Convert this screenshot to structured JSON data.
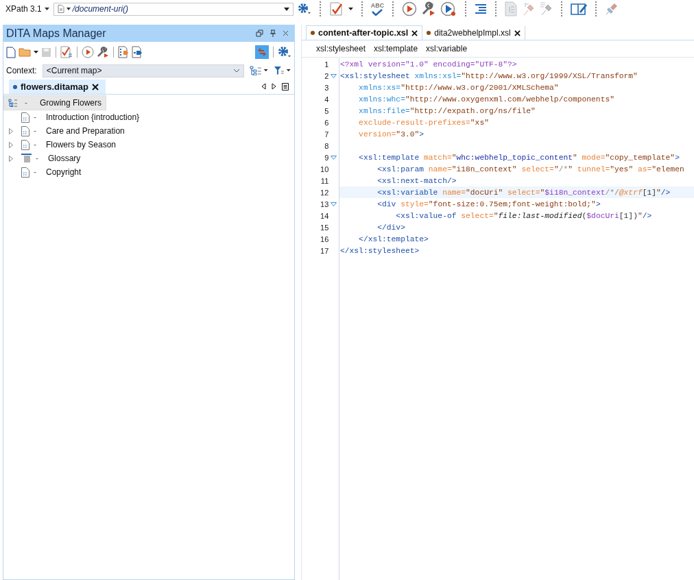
{
  "toolbar": {
    "xpath_version": "XPath 3.1",
    "xpath_expression": "/document-uri()",
    "spell_icon_text": "ABC"
  },
  "maps_manager": {
    "title": "DITA Maps Manager",
    "context_label": "Context:",
    "context_value": "<Current map>",
    "tabs": [
      {
        "label": "flowers.ditamap",
        "selected": true
      }
    ],
    "tree": [
      {
        "label": "Growing Flowers",
        "separator": "-",
        "kind": "map",
        "selected": true,
        "children": [
          {
            "label": "Introduction {introduction}",
            "separator": "-",
            "kind": "topic",
            "expandable": false,
            "selected": false
          },
          {
            "label": "Care and Preparation",
            "separator": "-",
            "kind": "topic",
            "expandable": true,
            "selected": false
          },
          {
            "label": "Flowers by Season",
            "separator": "-",
            "kind": "topic",
            "expandable": true,
            "selected": false
          },
          {
            "label": "Glossary",
            "separator": "-",
            "kind": "glossary",
            "expandable": true,
            "selected": false
          },
          {
            "label": "Copyright",
            "separator": "-",
            "kind": "topic",
            "expandable": false,
            "selected": false
          }
        ]
      }
    ]
  },
  "editor": {
    "tabs": [
      {
        "label": "content-after-topic.xsl",
        "selected": true
      },
      {
        "label": "dita2webhelpImpl.xsl",
        "selected": false
      }
    ],
    "breadcrumb": [
      "xsl:stylesheet",
      "xsl:template",
      "xsl:variable"
    ],
    "lines": [
      {
        "num": "1",
        "fold": false,
        "current": false,
        "tokens": [
          {
            "kind": "pi",
            "text": "<?xml version=\"1.0\" encoding=\"UTF-8\"?>"
          }
        ]
      },
      {
        "num": "2",
        "fold": true,
        "current": false,
        "tokens": [
          {
            "kind": "tag",
            "text": "<xsl:stylesheet "
          },
          {
            "kind": "ns",
            "text": "xmlns:xsl="
          },
          {
            "kind": "value",
            "text": "\"http://www.w3.org/1999/XSL/Transform\""
          }
        ]
      },
      {
        "num": "3",
        "fold": false,
        "current": false,
        "tokens": [
          {
            "kind": "ns",
            "text": "    xmlns:xs="
          },
          {
            "kind": "value",
            "text": "\"http://www.w3.org/2001/XMLSchema\""
          }
        ]
      },
      {
        "num": "4",
        "fold": false,
        "current": false,
        "tokens": [
          {
            "kind": "ns",
            "text": "    xmlns:whc="
          },
          {
            "kind": "value",
            "text": "\"http://www.oxygenxml.com/webhelp/components\""
          }
        ]
      },
      {
        "num": "5",
        "fold": false,
        "current": false,
        "tokens": [
          {
            "kind": "ns",
            "text": "    xmlns:file="
          },
          {
            "kind": "value",
            "text": "\"http://expath.org/ns/file\""
          }
        ]
      },
      {
        "num": "6",
        "fold": false,
        "current": false,
        "tokens": [
          {
            "kind": "attr",
            "text": "    exclude-result-prefixes="
          },
          {
            "kind": "value",
            "text": "\"xs\""
          }
        ]
      },
      {
        "num": "7",
        "fold": false,
        "current": false,
        "tokens": [
          {
            "kind": "attr",
            "text": "    version="
          },
          {
            "kind": "value",
            "text": "\"3.0\""
          },
          {
            "kind": "tag",
            "text": ">"
          }
        ]
      },
      {
        "num": "8",
        "fold": false,
        "current": false
      },
      {
        "num": "9",
        "fold": true,
        "current": false,
        "tokens": [
          {
            "kind": "tag",
            "text": "    <xsl:template "
          },
          {
            "kind": "attr",
            "text": "match="
          },
          {
            "kind": "value",
            "text": "\""
          },
          {
            "kind": "xpath",
            "text": "whc:webhelp_topic_content"
          },
          {
            "kind": "value",
            "text": "\" "
          },
          {
            "kind": "attr",
            "text": "mode="
          },
          {
            "kind": "value",
            "text": "\"copy_template\""
          },
          {
            "kind": "tag",
            "text": ">"
          }
        ]
      },
      {
        "num": "10",
        "fold": false,
        "current": false,
        "tokens": [
          {
            "kind": "tag",
            "text": "        <xsl:param "
          },
          {
            "kind": "attr",
            "text": "name="
          },
          {
            "kind": "value",
            "text": "\"i18n_context\" "
          },
          {
            "kind": "attr",
            "text": "select="
          },
          {
            "kind": "value",
            "text": "\""
          },
          {
            "kind": "op",
            "text": "/*"
          },
          {
            "kind": "value",
            "text": "\" "
          },
          {
            "kind": "attr",
            "text": "tunnel="
          },
          {
            "kind": "value",
            "text": "\"yes\" "
          },
          {
            "kind": "attr",
            "text": "as="
          },
          {
            "kind": "value",
            "text": "\"elemen"
          }
        ]
      },
      {
        "num": "11",
        "fold": false,
        "current": false,
        "tokens": [
          {
            "kind": "tag",
            "text": "        <xsl:next-match/>"
          }
        ]
      },
      {
        "num": "12",
        "fold": false,
        "current": true,
        "tokens": [
          {
            "kind": "tag",
            "text": "        <xsl:variable "
          },
          {
            "kind": "attr",
            "text": "name="
          },
          {
            "kind": "value",
            "text": "\"docUri\" "
          },
          {
            "kind": "attr",
            "text": "select="
          },
          {
            "kind": "value",
            "text": "\""
          },
          {
            "kind": "var",
            "text": "$i18n_context"
          },
          {
            "kind": "op",
            "text": "/*/"
          },
          {
            "kind": "axis",
            "text": "@xtrf"
          },
          {
            "kind": "punct",
            "text": "[1]"
          },
          {
            "kind": "value",
            "text": "\""
          },
          {
            "kind": "tag",
            "text": "/>"
          }
        ]
      },
      {
        "num": "13",
        "fold": true,
        "current": false,
        "tokens": [
          {
            "kind": "tag",
            "text": "        <div "
          },
          {
            "kind": "attr",
            "text": "style="
          },
          {
            "kind": "value",
            "text": "\"font-size:0.75em;font-weight:bold;\""
          },
          {
            "kind": "tag",
            "text": ">"
          }
        ]
      },
      {
        "num": "14",
        "fold": false,
        "current": false,
        "tokens": [
          {
            "kind": "tag",
            "text": "            <xsl:value-of "
          },
          {
            "kind": "attr",
            "text": "select="
          },
          {
            "kind": "value",
            "text": "\""
          },
          {
            "kind": "func",
            "text": "file:last-modified"
          },
          {
            "kind": "punct",
            "text": "("
          },
          {
            "kind": "var",
            "text": "$docUri"
          },
          {
            "kind": "punct",
            "text": "[1])"
          },
          {
            "kind": "value",
            "text": "\""
          },
          {
            "kind": "tag",
            "text": "/>"
          }
        ]
      },
      {
        "num": "15",
        "fold": false,
        "current": false,
        "tokens": [
          {
            "kind": "tag",
            "text": "        </div>"
          }
        ]
      },
      {
        "num": "16",
        "fold": false,
        "current": false,
        "tokens": [
          {
            "kind": "tag",
            "text": "    </xsl:template>"
          }
        ]
      },
      {
        "num": "17",
        "fold": false,
        "current": false,
        "tokens": [
          {
            "kind": "tag",
            "text": "</xsl:stylesheet>"
          }
        ]
      }
    ]
  }
}
